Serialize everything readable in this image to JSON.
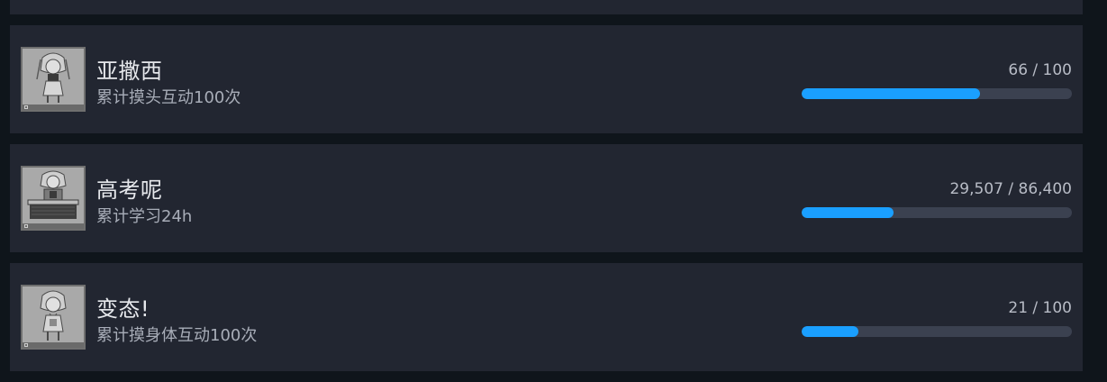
{
  "achievements": [
    {
      "title": "亚撒西",
      "description": "累计摸头互动100次",
      "progress_text": "66 / 100",
      "progress_fraction": 0.66,
      "icon": "girl-standing-icon"
    },
    {
      "title": "高考呢",
      "description": "累计学习24h",
      "progress_text": "29,507 / 86,400",
      "progress_fraction": 0.3415,
      "icon": "girl-at-desk-icon"
    },
    {
      "title": "变态!",
      "description": "累计摸身体互动100次",
      "progress_text": "21 / 100",
      "progress_fraction": 0.21,
      "icon": "girl-shy-icon"
    }
  ],
  "colors": {
    "card_bg": "#222631",
    "page_bg": "#0f151b",
    "bar_fill": "#1a9fff",
    "bar_track": "#3b4150"
  }
}
